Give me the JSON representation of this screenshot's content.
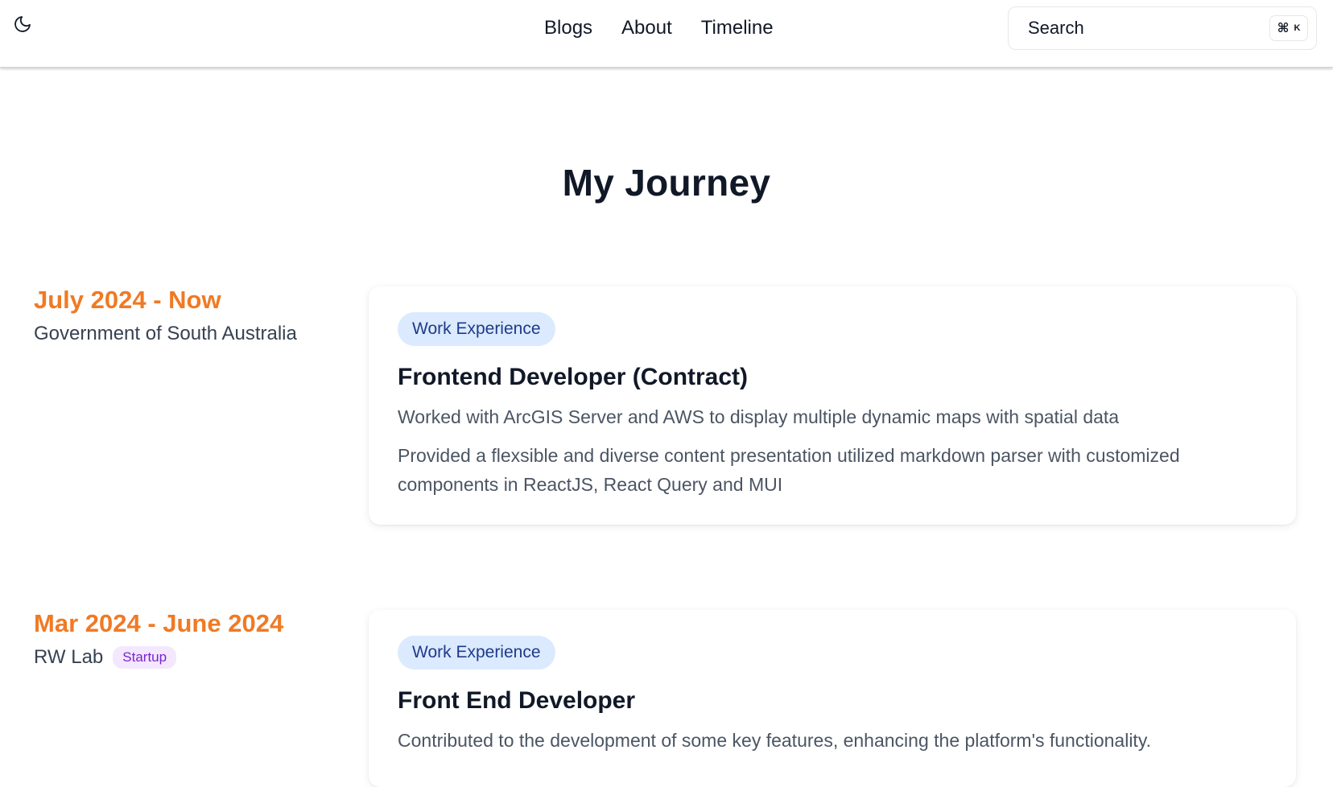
{
  "header": {
    "theme_icon": "moon-icon",
    "nav": [
      {
        "label": "Blogs"
      },
      {
        "label": "About"
      },
      {
        "label": "Timeline"
      }
    ],
    "search": {
      "label": "Search",
      "shortcut_symbol": "⌘",
      "shortcut_key": "K"
    }
  },
  "main": {
    "title": "My Journey",
    "entries": [
      {
        "date": "July 2024 - Now",
        "organization": "Government of South Australia",
        "tag": "Work Experience",
        "role": "Frontend Developer (Contract)",
        "descriptions": [
          "Worked with ArcGIS Server and AWS to display multiple dynamic maps with spatial data",
          "Provided a flexsible and diverse content presentation utilized markdown parser with customized components in ReactJS, React Query and MUI"
        ]
      },
      {
        "date": "Mar 2024 - June 2024",
        "organization": "RW Lab",
        "org_badge": "Startup",
        "tag": "Work Experience",
        "role": "Front End Developer",
        "descriptions": [
          "Contributed to the development of some key features, enhancing the platform's functionality."
        ]
      }
    ]
  },
  "colors": {
    "accent_date": "#f07a24",
    "tag_bg": "#dbeafe",
    "tag_text": "#1e3a8a",
    "badge_bg": "#f3e8ff",
    "badge_text": "#7e22ce"
  }
}
